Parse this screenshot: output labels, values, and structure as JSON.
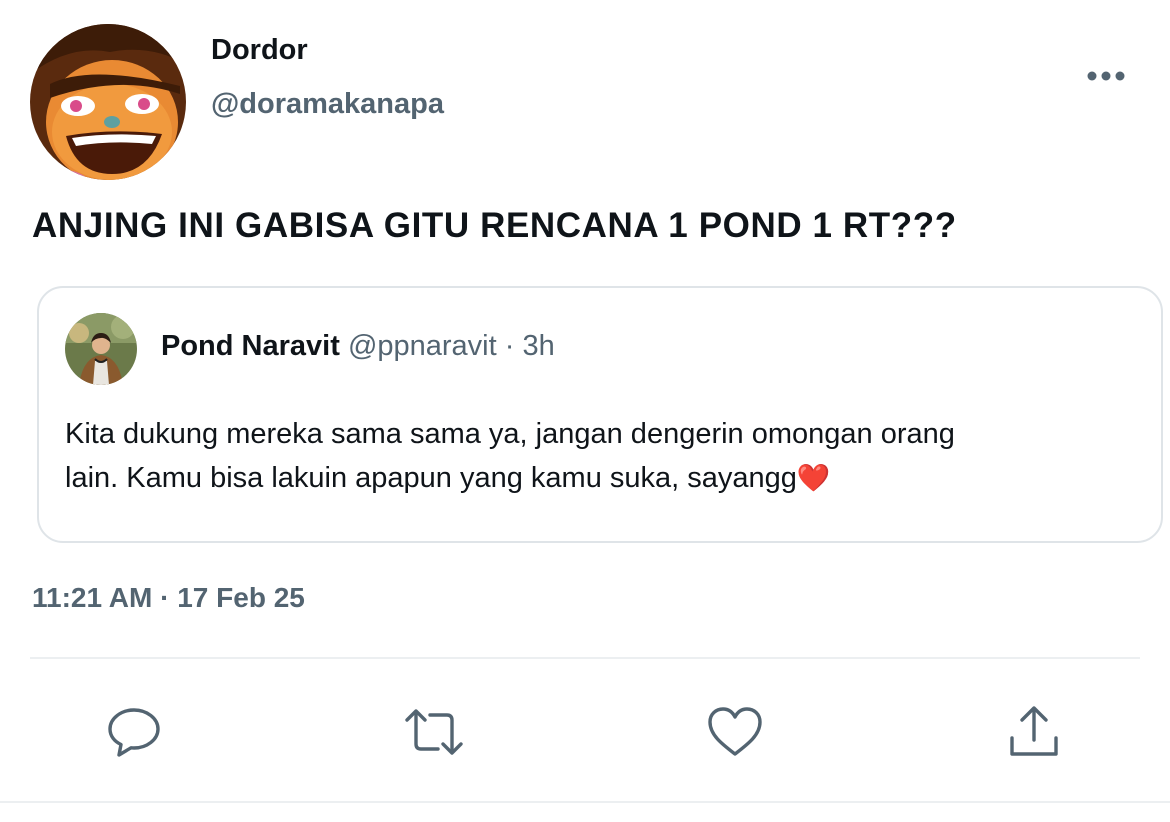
{
  "author": {
    "display_name": "Dordor",
    "handle": "@doramakanapa",
    "avatar_icon": "cartoon-face-avatar"
  },
  "tweet": {
    "text": "ANJING INI GABISA GITU RENCANA 1 POND 1 RT???",
    "timestamp": "11:21 AM · 17 Feb 25"
  },
  "quoted_tweet": {
    "display_name": "Pond Naravit",
    "handle": "@ppnaravit",
    "separator": "·",
    "age": "3h",
    "text_line1": "Kita dukung mereka sama sama ya, jangan dengerin omongan orang",
    "text_line2": "lain. Kamu bisa lakuin apapun yang kamu suka, sayangg",
    "emoji": "❤️",
    "avatar_icon": "person-photo-avatar"
  },
  "actions": {
    "reply_icon": "reply-icon",
    "retweet_icon": "retweet-icon",
    "like_icon": "heart-icon",
    "share_icon": "share-icon"
  },
  "colors": {
    "primary_text": "#0f1419",
    "secondary_text": "#536471",
    "border": "#dfe4e8",
    "emoji_heart": "#e8263c"
  }
}
